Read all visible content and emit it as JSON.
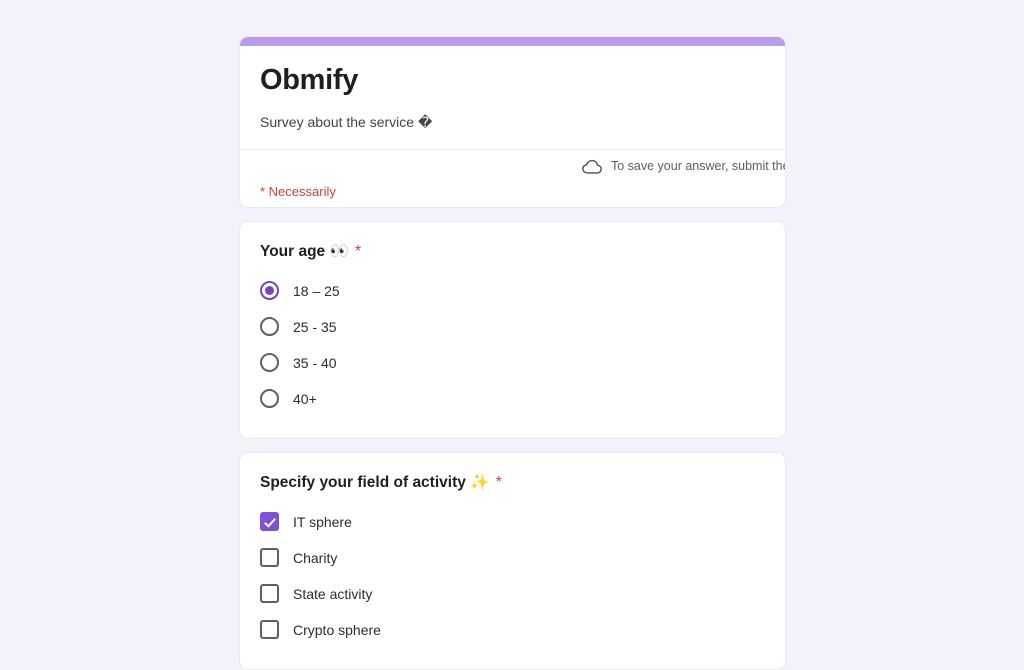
{
  "page": {
    "background_color": "#f4f1fb",
    "accent_color": "#b99de8",
    "selected_color": "#7b44bd",
    "checkbox_color": "#8250d8",
    "required_color": "#d93b3b"
  },
  "header": {
    "title": "Obmify",
    "description": "Survey about the service �",
    "save_note": "To save your answer, submit the form",
    "save_icon": "cloud-icon",
    "required_note": "* Necessarily"
  },
  "questions": [
    {
      "title": "Your age",
      "emoji": "👀",
      "required_marker": "*",
      "type": "radio",
      "options": [
        {
          "label": "18 – 25",
          "selected": true
        },
        {
          "label": "25 - 35",
          "selected": false
        },
        {
          "label": "35 - 40",
          "selected": false
        },
        {
          "label": "40+",
          "selected": false
        }
      ]
    },
    {
      "title": "Specify your field of activity",
      "emoji": "✨",
      "required_marker": "*",
      "type": "checkbox",
      "options": [
        {
          "label": "IT sphere",
          "selected": true
        },
        {
          "label": "Charity",
          "selected": false
        },
        {
          "label": "State activity",
          "selected": false
        },
        {
          "label": "Crypto sphere",
          "selected": false
        }
      ]
    }
  ]
}
